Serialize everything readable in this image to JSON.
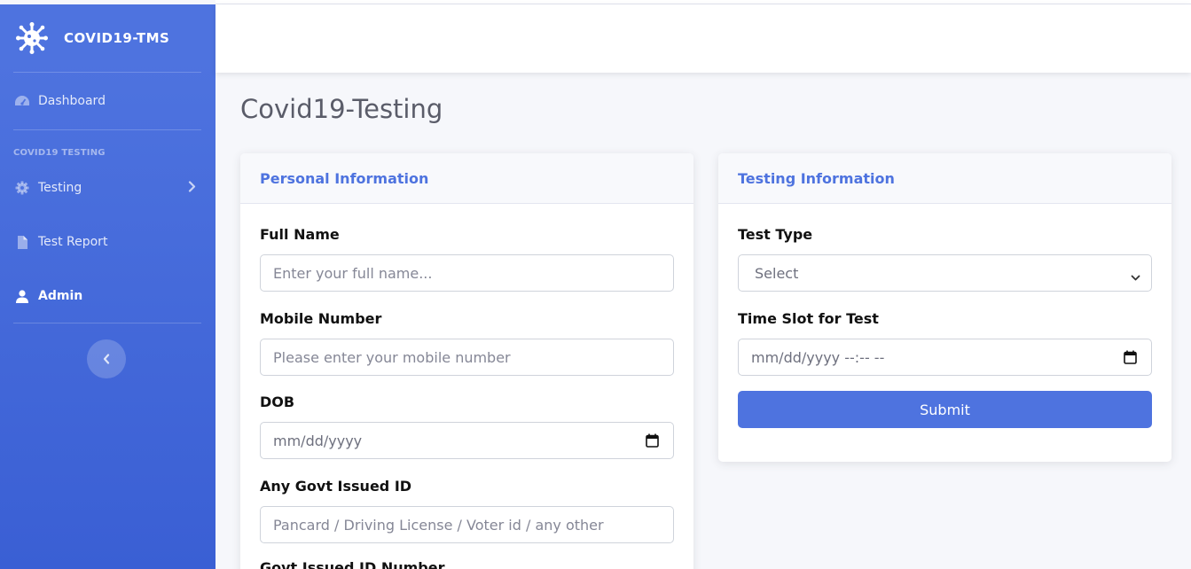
{
  "sidebar": {
    "brand": "COVID19-TMS",
    "items": [
      {
        "label": "Dashboard",
        "icon": "dashboard-icon"
      },
      {
        "label": "Testing",
        "icon": "gear-icon"
      },
      {
        "label": "Test Report",
        "icon": "file-icon"
      },
      {
        "label": "Admin",
        "icon": "user-icon"
      }
    ],
    "section_heading": "COVID19 TESTING"
  },
  "main": {
    "title": "Covid19-Testing",
    "personal": {
      "header": "Personal Information",
      "full_name_label": "Full Name",
      "full_name_placeholder": "Enter your full name...",
      "mobile_label": "Mobile Number",
      "mobile_placeholder": "Please enter your mobile number",
      "dob_label": "DOB",
      "dob_value": "mm/dd/yyyy",
      "govt_id_label": "Any Govt Issued ID",
      "govt_id_placeholder": "Pancard / Driving License / Voter id / any other",
      "govt_id_number_label": "Govt Issued ID Number"
    },
    "testing": {
      "header": "Testing Information",
      "test_type_label": "Test Type",
      "test_type_value": "Select",
      "time_slot_label": "Time Slot for Test",
      "time_slot_value": "mm/dd/yyyy --:-- --",
      "submit_label": "Submit"
    }
  },
  "colors": {
    "primary": "#4e73df",
    "background": "#f6f7fb"
  }
}
